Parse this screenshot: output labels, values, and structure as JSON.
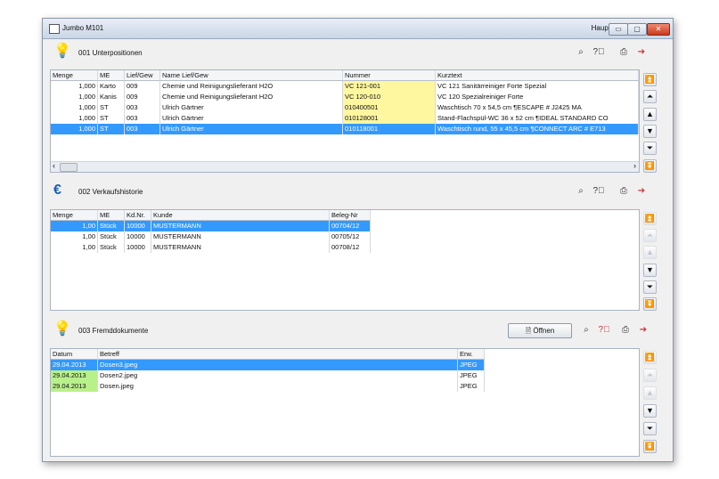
{
  "window": {
    "title": "Jumbo M101",
    "menu_label": "Haupt",
    "minimize": "▭",
    "maximize": "▢",
    "close": "✕"
  },
  "toolbar_icons": {
    "find": "binoculars-icon",
    "help": "help-icon",
    "print": "printer-icon",
    "export": "export-icon"
  },
  "sections": {
    "s1": {
      "icon": "lightbulb-icon",
      "title": "001 Unterpositionen",
      "headers": [
        "Menge",
        "ME",
        "Lief/Gew",
        "Name Lief/Gew",
        "Nummer",
        "Kurztext"
      ],
      "rows": [
        [
          "1,000",
          "Karto",
          "009",
          "Chemie und Reinigungslieferant H2O",
          "VC 121-001",
          "VC 121 Sanitärreiniger Forte Spezial"
        ],
        [
          "1,000",
          "Kanis",
          "009",
          "Chemie und Reinigungslieferant H2O",
          "VC 120-010",
          "VC 120 Spezialreiniger Forte"
        ],
        [
          "1,000",
          "ST",
          "003",
          "Ulrich Gärtner",
          "010400501",
          "Waschtisch  70 x 54,5 cm ¶ESCAPE # J2425 MA"
        ],
        [
          "1,000",
          "ST",
          "003",
          "Ulrich Gärtner",
          "010128001",
          "Stand-Flachspül-WC 36 x 52 cm ¶IDEAL STANDARD CO"
        ],
        [
          "1,000",
          "ST",
          "003",
          "Ulrich Gärtner",
          "010118001",
          "Waschtisch rund, 55 x 45,5 cm ¶CONNECT ARC # E713"
        ]
      ],
      "selected_row": 4
    },
    "s2": {
      "icon": "euro-icon",
      "title": "002 Verkaufshistorie",
      "headers": [
        "Menge",
        "ME",
        "Kd.Nr.",
        "Kunde",
        "Beleg-Nr"
      ],
      "rows": [
        [
          "1,00",
          "Stück",
          "10000",
          "MUSTERMANN",
          "00704/12"
        ],
        [
          "1,00",
          "Stück",
          "10000",
          "MUSTERMANN",
          "00705/12"
        ],
        [
          "1,00",
          "Stück",
          "10000",
          "MUSTERMANN",
          "00708/12"
        ]
      ],
      "selected_row": 0
    },
    "s3": {
      "icon": "lightbulb-icon",
      "title": "003 Fremddokumente",
      "open_label": "Öffnen",
      "headers": [
        "Datum",
        "Betreff",
        "Erw."
      ],
      "rows": [
        [
          "29.04.2013",
          "Dosen3.jpeg",
          "JPEG"
        ],
        [
          "29.04.2013",
          "Dosen2.jpeg",
          "JPEG"
        ],
        [
          "29.04.2013",
          "Dosen.jpeg",
          "JPEG"
        ]
      ],
      "selected_row": 0
    }
  },
  "nav_glyphs": {
    "first": "⏫",
    "prev_page": "⏶",
    "prev": "▲",
    "next": "▼",
    "next_page": "⏷",
    "last": "⏬",
    "scroll_left": "‹",
    "scroll_right": "›"
  },
  "colors": {
    "selection": "#3399ff",
    "number_highlight": "#fff6a0",
    "date_highlight": "#b8f08a"
  }
}
